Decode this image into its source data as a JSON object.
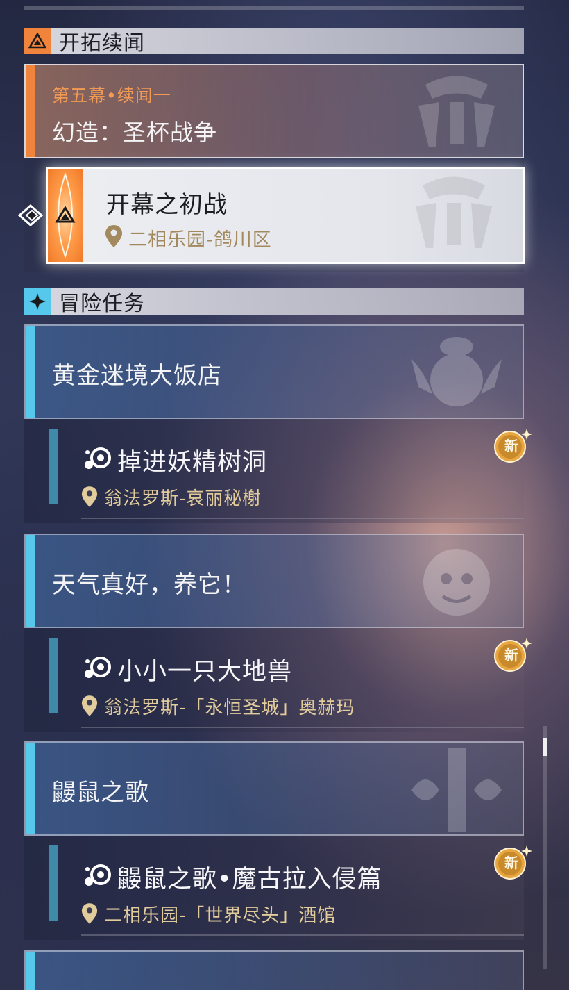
{
  "trailblaze": {
    "section_title": "开拓续闻",
    "chapter": "第五幕•续闻一",
    "quest_title": "幻造：圣杯战争",
    "sub_quest": {
      "name": "开幕之初战",
      "location": "二相乐园-鸽川区"
    }
  },
  "adventure": {
    "section_title": "冒险任务",
    "quests": [
      {
        "title": "黄金迷境大饭店",
        "sub": {
          "name": "掉进妖精树洞",
          "location": "翁法罗斯-哀丽秘榭",
          "badge": "新"
        }
      },
      {
        "title": "天气真好，养它！",
        "sub": {
          "name": "小小一只大地兽",
          "location": "翁法罗斯-「永恒圣城」奥赫玛",
          "badge": "新"
        }
      },
      {
        "title": "鼹鼠之歌",
        "sub": {
          "name": "鼹鼠之歌•魔古拉入侵篇",
          "location": "二相乐园-「世界尽头」酒馆",
          "badge": "新"
        }
      }
    ]
  },
  "colors": {
    "trailblaze_accent": "#f0843c",
    "adventure_accent": "#56c8ec",
    "location_text": "#e2cc9c",
    "badge": "#e8a640"
  },
  "icons": [
    "trailblaze-icon",
    "adventure-icon",
    "selector-arrow-icon",
    "location-pin-icon",
    "quest-type-icon",
    "new-badge-icon"
  ]
}
